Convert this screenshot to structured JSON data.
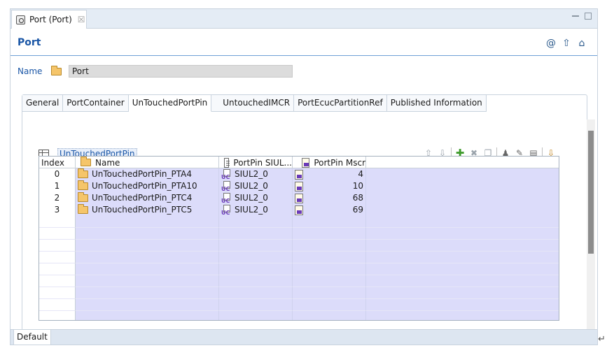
{
  "editor_tab": {
    "label": "Port (Port)",
    "close": "☒"
  },
  "page": {
    "title": "Port"
  },
  "name_field": {
    "label": "Name",
    "value": "Port"
  },
  "config_tabs": [
    {
      "label": "General"
    },
    {
      "label": "PortContainer"
    },
    {
      "label": "UnTouchedPortPin"
    },
    {
      "label": "UntouchedIMCR"
    },
    {
      "label": "PortEcucPartitionRef"
    },
    {
      "label": "Published Information"
    }
  ],
  "active_tab": "UnTouchedPortPin",
  "section": {
    "title": "UnTouchedPortPin"
  },
  "table": {
    "columns": {
      "index": "Index",
      "name": "Name",
      "siul": "PortPin SIUL...",
      "mscr": "PortPin Mscr"
    },
    "rows": [
      {
        "index": "0",
        "name": "UnTouchedPortPin_PTA4",
        "siul": "SIUL2_0",
        "mscr": "4"
      },
      {
        "index": "1",
        "name": "UnTouchedPortPin_PTA10",
        "siul": "SIUL2_0",
        "mscr": "10"
      },
      {
        "index": "2",
        "name": "UnTouchedPortPin_PTC4",
        "siul": "SIUL2_0",
        "mscr": "68"
      },
      {
        "index": "3",
        "name": "UnTouchedPortPin_PTC5",
        "siul": "SIUL2_0",
        "mscr": "69"
      }
    ]
  },
  "bottom_tab": {
    "label": "Default"
  },
  "colors": {
    "accent": "#1a56a6",
    "row_highlight": "#dcdcfa",
    "add_green": "#3f9b2c"
  }
}
